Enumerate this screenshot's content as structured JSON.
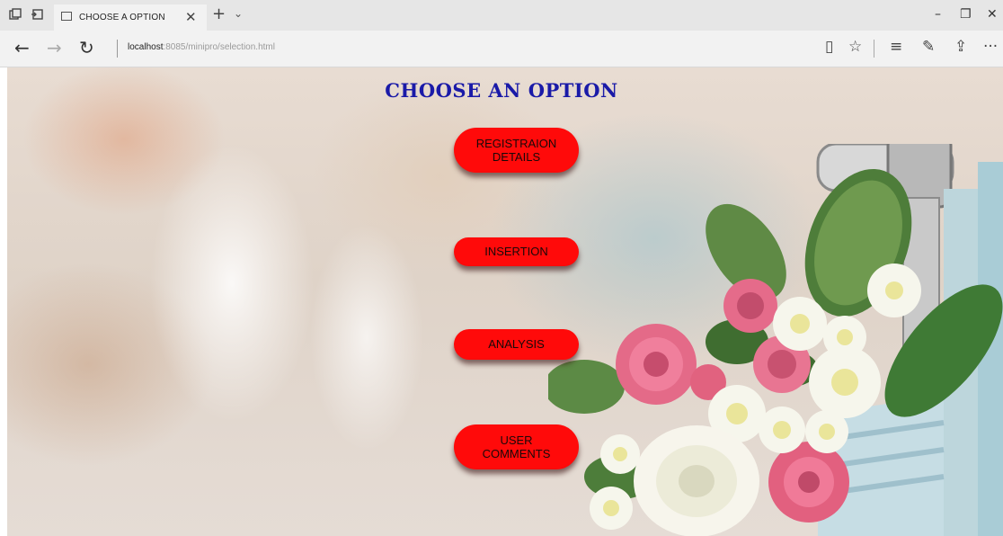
{
  "browser": {
    "tab_title": "CHOOSE A OPTION",
    "tab_close_glyph": "✕",
    "new_tab_glyph": "+",
    "tab_list_glyph": "⌄",
    "window_controls": {
      "minimize": "–",
      "maximize": "❐",
      "close": "✕"
    },
    "nav": {
      "back": "←",
      "forward": "→",
      "refresh": "↻"
    },
    "address": {
      "host": "localhost",
      "rest": ":8085/minipro/selection.html"
    },
    "tools": {
      "reading_view": "▯",
      "favorite": "☆",
      "hub": "≡",
      "notes": "✎",
      "share": "⇪",
      "more": "···"
    },
    "icons": [
      "tab-preview-icon",
      "set-aside-tabs-icon",
      "page-icon",
      "close-icon",
      "plus-icon",
      "chevron-down-icon",
      "minimize-icon",
      "restore-icon",
      "back-arrow-icon",
      "forward-arrow-icon",
      "refresh-icon",
      "reading-view-icon",
      "star-icon",
      "hub-icon",
      "pen-icon",
      "share-icon",
      "more-icon"
    ]
  },
  "page": {
    "heading": "CHOOSE AN OPTION",
    "heading_color": "#1a1aa8",
    "button_color": "#ff0a0a",
    "options": [
      {
        "label": "REGISTRAION DETAILS"
      },
      {
        "label": "INSERTION"
      },
      {
        "label": "ANALYSIS"
      },
      {
        "label": "USER COMMENTS"
      }
    ]
  }
}
